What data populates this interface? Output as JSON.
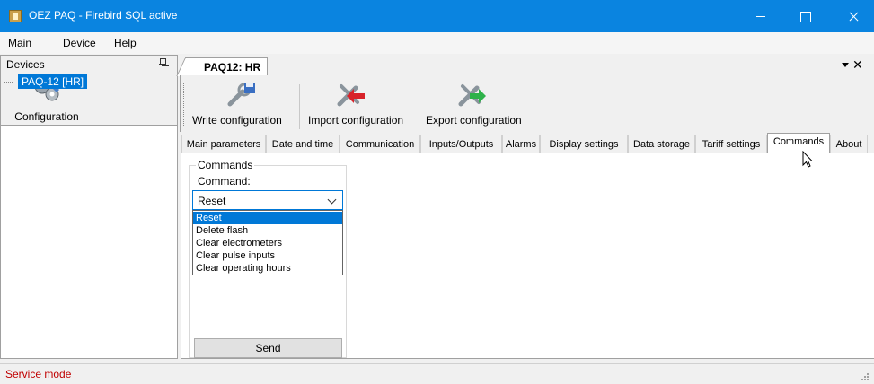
{
  "window": {
    "title": "OEZ PAQ - Firebird SQL active"
  },
  "menu": {
    "items": [
      "Main",
      "Device",
      "Help"
    ]
  },
  "left_panel": {
    "header": "Devices",
    "config_button": "Configuration",
    "tree": {
      "selected": "PAQ-12 [HR]"
    }
  },
  "document_tab": {
    "label": "PAQ12: HR"
  },
  "toolbar": {
    "write": "Write configuration",
    "import": "Import configuration",
    "export": "Export configuration"
  },
  "tabs": [
    "Main parameters",
    "Date and time",
    "Communication",
    "Inputs/Outputs",
    "Alarms",
    "Display settings",
    "Data storage",
    "Tariff settings",
    "Commands",
    "About"
  ],
  "active_tab": "Commands",
  "commands": {
    "group_label": "Commands",
    "command_label": "Command:",
    "selected_value": "Reset",
    "options": [
      "Reset",
      "Delete flash",
      "Clear electrometers",
      "Clear pulse inputs",
      "Clear operating hours"
    ],
    "send_label": "Send"
  },
  "status": {
    "text": "Service mode"
  },
  "colors": {
    "titlebar": "#0a84e0",
    "selection": "#0078d7",
    "status_text": "#c00000"
  }
}
